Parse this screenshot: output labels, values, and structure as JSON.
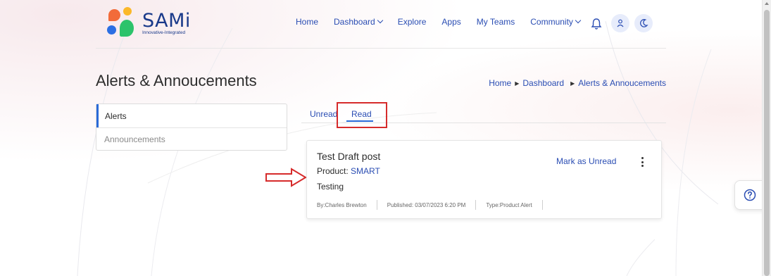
{
  "header": {
    "brand_name": "SAMi",
    "brand_tagline": "Innovative-Integrated",
    "nav": {
      "home": "Home",
      "dashboard": "Dashboard",
      "explore": "Explore",
      "apps": "Apps",
      "my_teams": "My Teams",
      "community": "Community"
    },
    "icons": [
      "bell-icon",
      "user-icon",
      "moon-icon"
    ]
  },
  "page": {
    "title": "Alerts & Annoucements",
    "breadcrumb": [
      "Home",
      "Dashboard",
      "Alerts & Annoucements"
    ]
  },
  "sidebar": {
    "items": [
      {
        "label": "Alerts",
        "active": true
      },
      {
        "label": "Announcements",
        "active": false
      }
    ]
  },
  "tabs": {
    "unread": "Unread",
    "read": "Read",
    "selected": "Read"
  },
  "card": {
    "title": "Test Draft post",
    "product_label": "Product:",
    "product_value": "SMART",
    "body": "Testing",
    "mark_action": "Mark as Unread",
    "meta": {
      "author": "By:Charles Brewton",
      "published": "Published: 03/07/2023 6:20 PM",
      "type": "Type:Product Alert"
    }
  },
  "colors": {
    "accent": "#2a4db3",
    "active_indicator": "#2a6ad8",
    "annotation_red": "#d62b2b",
    "logo_orange": "#f26b3a",
    "logo_yellow": "#fbb829",
    "logo_blue": "#2b6fe3",
    "logo_green": "#2cc36b"
  },
  "help": {
    "icon": "help-icon"
  }
}
